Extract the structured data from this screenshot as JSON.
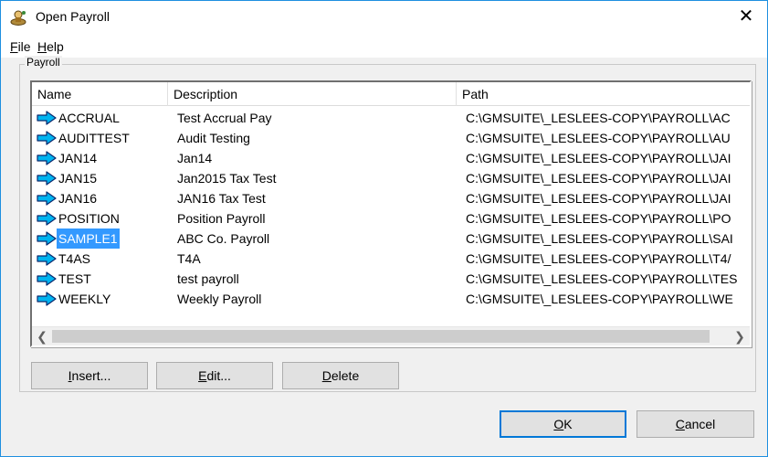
{
  "window": {
    "title": "Open Payroll",
    "close_glyph": "✕"
  },
  "menu": {
    "file": "File",
    "help": "Help"
  },
  "group": {
    "label": "Payroll"
  },
  "columns": {
    "name": "Name",
    "description": "Description",
    "path": "Path"
  },
  "rows": [
    {
      "name": "ACCRUAL",
      "description": "Test Accrual Pay",
      "path": "C:\\GMSUITE\\_LESLEES-COPY\\PAYROLL\\AC"
    },
    {
      "name": "AUDITTEST",
      "description": "Audit Testing",
      "path": "C:\\GMSUITE\\_LESLEES-COPY\\PAYROLL\\AU"
    },
    {
      "name": "JAN14",
      "description": "Jan14",
      "path": "C:\\GMSUITE\\_LESLEES-COPY\\PAYROLL\\JAI"
    },
    {
      "name": "JAN15",
      "description": "Jan2015 Tax Test",
      "path": "C:\\GMSUITE\\_LESLEES-COPY\\PAYROLL\\JAI"
    },
    {
      "name": "JAN16",
      "description": "JAN16 Tax Test",
      "path": "C:\\GMSUITE\\_LESLEES-COPY\\PAYROLL\\JAI"
    },
    {
      "name": "POSITION",
      "description": "Position Payroll",
      "path": "C:\\GMSUITE\\_LESLEES-COPY\\PAYROLL\\PO"
    },
    {
      "name": "SAMPLE1",
      "description": "ABC Co. Payroll",
      "path": "C:\\GMSUITE\\_LESLEES-COPY\\PAYROLL\\SAI"
    },
    {
      "name": "T4AS",
      "description": "T4A",
      "path": "C:\\GMSUITE\\_LESLEES-COPY\\PAYROLL\\T4/"
    },
    {
      "name": "TEST",
      "description": "test payroll",
      "path": "C:\\GMSUITE\\_LESLEES-COPY\\PAYROLL\\TES"
    },
    {
      "name": "WEEKLY",
      "description": "Weekly Payroll",
      "path": "C:\\GMSUITE\\_LESLEES-COPY\\PAYROLL\\WE"
    }
  ],
  "selected_row": "SAMPLE1",
  "buttons": {
    "insert": "Insert...",
    "edit": "Edit...",
    "delete": "Delete",
    "ok": "OK",
    "cancel": "Cancel"
  },
  "icons": {
    "row": "right-arrow-icon",
    "app": "payroll-app-icon"
  },
  "colors": {
    "arrow_fill": "#00b4f0",
    "arrow_stroke": "#0a2a6e",
    "selection": "#3399ff",
    "window_border": "#1e8fe0"
  }
}
